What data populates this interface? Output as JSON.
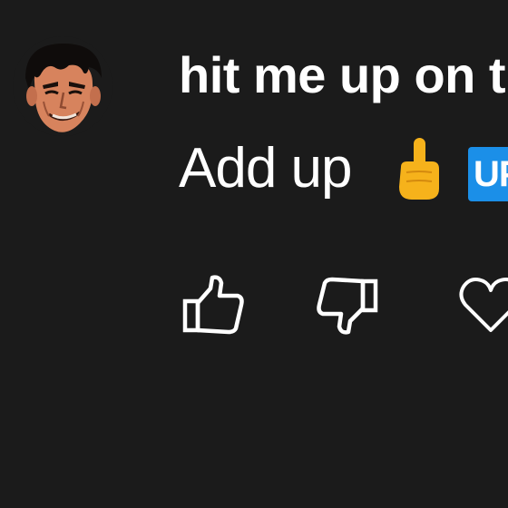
{
  "comment": {
    "author": "hit me up on t",
    "text": "Add up",
    "emoji": [
      "pointing-up-icon",
      "up-button-icon"
    ],
    "up_icon_text": "UP"
  },
  "actions": [
    "like-icon",
    "dislike-icon",
    "heart-icon"
  ],
  "colors": {
    "background": "#1b1b1b",
    "text": "#ffffff",
    "up_badge": "#1b8fe8",
    "emoji_yellow": "#f6b21b"
  }
}
